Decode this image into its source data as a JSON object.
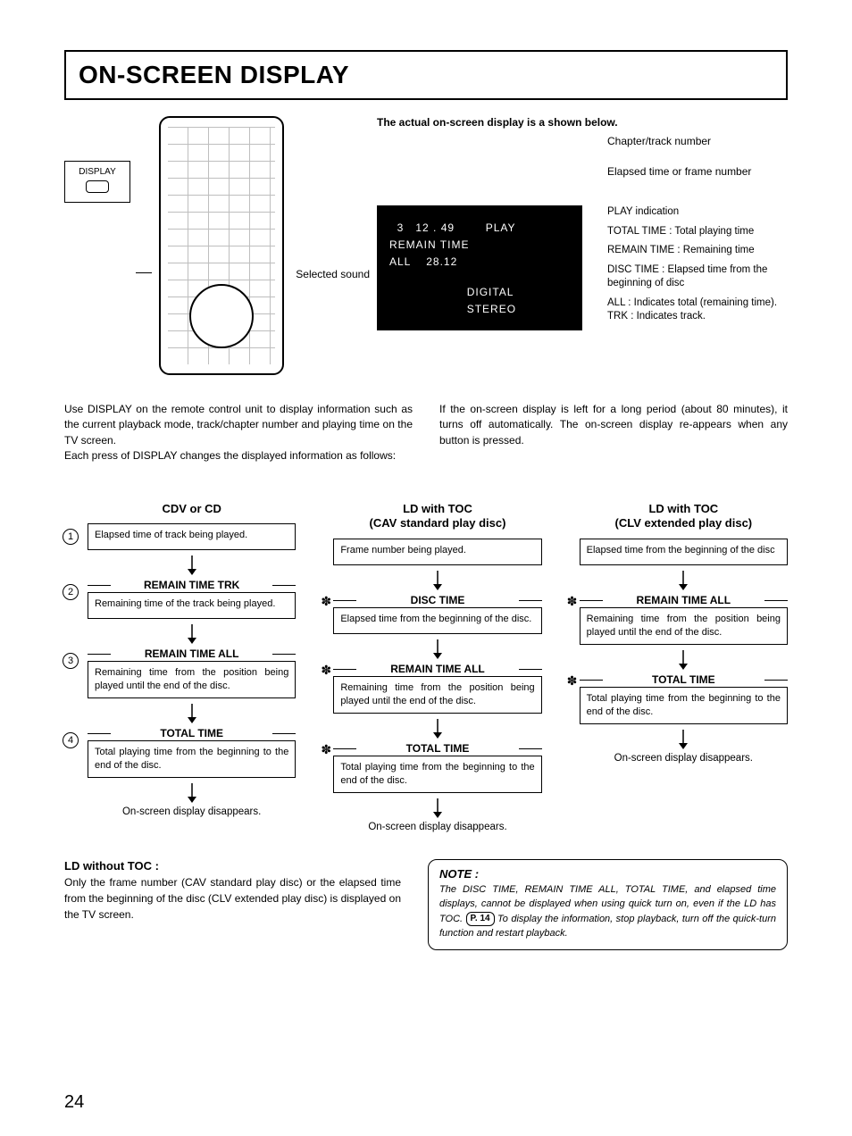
{
  "title": "ON-SCREEN DISPLAY",
  "remote": {
    "display_label": "DISPLAY"
  },
  "osd_caption": "The actual on-screen display is a shown below.",
  "osd": {
    "line1_chapter": "3",
    "line1_time": "12 . 49",
    "line1_play": "PLAY",
    "line2_label": "REMAIN TIME",
    "line3_all": "ALL",
    "line3_value": "28.12",
    "bottom1": "DIGITAL",
    "bottom2": "STEREO"
  },
  "callouts": {
    "selected_sound": "Selected sound",
    "chapter": "Chapter/track number",
    "elapsed": "Elapsed time or frame number",
    "play_ind": "PLAY indication",
    "total_time": "TOTAL TIME : Total playing time",
    "remain_time": "REMAIN TIME : Remaining time",
    "disc_time": "DISC TIME : Elapsed time from the beginning of disc",
    "all_trk": "ALL : Indicates total (remaining time).\nTRK : Indicates track."
  },
  "para_left": "Use DISPLAY on the remote control unit to display information such as the current playback mode, track/chapter number and playing time on the TV screen.\nEach press of DISPLAY changes the displayed information as follows:",
  "para_right": "If the on-screen display is left for a long period (about 80 minutes), it turns off automatically. The on-screen display re-appears when any button is pressed.",
  "flows": {
    "col1": {
      "heading": "CDV or CD",
      "items": [
        {
          "num": "1",
          "label": "",
          "box": "Elapsed time of track being played."
        },
        {
          "num": "2",
          "label": "REMAIN TIME TRK",
          "box": "Remaining time of the track being played."
        },
        {
          "num": "3",
          "label": "REMAIN TIME ALL",
          "box": "Remaining time from the position being played until the end of the disc."
        },
        {
          "num": "4",
          "label": "TOTAL TIME",
          "box": "Total playing time from the beginning to the end of the disc."
        }
      ],
      "end": "On-screen display disappears."
    },
    "col2": {
      "heading": "LD with TOC\n(CAV standard play disc)",
      "items": [
        {
          "star": false,
          "label": "",
          "box": "Frame number being played."
        },
        {
          "star": true,
          "label": "DISC TIME",
          "box": "Elapsed time from the beginning of the disc."
        },
        {
          "star": true,
          "label": "REMAIN TIME ALL",
          "box": "Remaining time from the position being played until the end of the disc."
        },
        {
          "star": true,
          "label": "TOTAL TIME",
          "box": "Total playing time from the beginning to the end of the disc."
        }
      ],
      "end": "On-screen display disappears."
    },
    "col3": {
      "heading": "LD with TOC\n(CLV extended play disc)",
      "items": [
        {
          "star": false,
          "label": "",
          "box": "Elapsed time from the beginning of the disc"
        },
        {
          "star": true,
          "label": "REMAIN TIME ALL",
          "box": "Remaining time from the position being played until the end of the disc."
        },
        {
          "star": true,
          "label": "TOTAL TIME",
          "box": "Total playing time from the beginning to the end of the disc."
        }
      ],
      "end": "On-screen display disappears."
    }
  },
  "bottom": {
    "ld_heading": "LD without TOC :",
    "ld_text": "Only the frame number (CAV standard play disc) or the elapsed time from the beginning of the disc (CLV extended play disc) is displayed on the TV screen.",
    "note_head": "NOTE :",
    "note_text_a": "The DISC TIME, REMAIN TIME ALL, TOTAL TIME, and elapsed time displays, cannot be displayed when using quick turn on, even if the LD has TOC. ",
    "note_pref": "P. 14",
    "note_text_b": " To display the information, stop playback, turn off the quick-turn function and restart playback."
  },
  "page_number": "24"
}
